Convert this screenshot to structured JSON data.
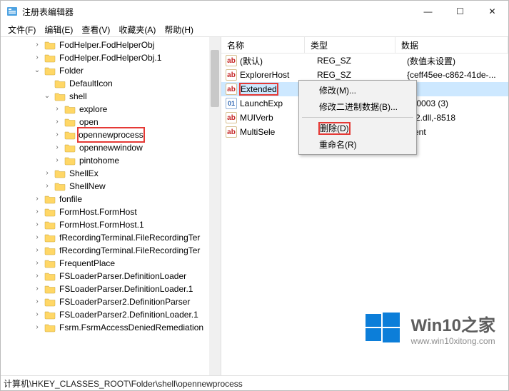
{
  "title": "注册表编辑器",
  "menu": {
    "file": "文件(F)",
    "edit": "编辑(E)",
    "view": "查看(V)",
    "fav": "收藏夹(A)",
    "help": "帮助(H)"
  },
  "tree": [
    {
      "d": 3,
      "tw": ">",
      "l": "FodHelper.FodHelperObj"
    },
    {
      "d": 3,
      "tw": ">",
      "l": "FodHelper.FodHelperObj.1"
    },
    {
      "d": 3,
      "tw": "v",
      "l": "Folder"
    },
    {
      "d": 4,
      "tw": "",
      "l": "DefaultIcon"
    },
    {
      "d": 4,
      "tw": "v",
      "l": "shell"
    },
    {
      "d": 5,
      "tw": ">",
      "l": "explore"
    },
    {
      "d": 5,
      "tw": ">",
      "l": "open"
    },
    {
      "d": 5,
      "tw": ">",
      "l": "opennewprocess",
      "hl": true
    },
    {
      "d": 5,
      "tw": ">",
      "l": "opennewwindow"
    },
    {
      "d": 5,
      "tw": ">",
      "l": "pintohome"
    },
    {
      "d": 4,
      "tw": ">",
      "l": "ShellEx"
    },
    {
      "d": 4,
      "tw": ">",
      "l": "ShellNew"
    },
    {
      "d": 3,
      "tw": ">",
      "l": "fonfile"
    },
    {
      "d": 3,
      "tw": ">",
      "l": "FormHost.FormHost"
    },
    {
      "d": 3,
      "tw": ">",
      "l": "FormHost.FormHost.1"
    },
    {
      "d": 3,
      "tw": ">",
      "l": "fRecordingTerminal.FileRecordingTer"
    },
    {
      "d": 3,
      "tw": ">",
      "l": "fRecordingTerminal.FileRecordingTer"
    },
    {
      "d": 3,
      "tw": ">",
      "l": "FrequentPlace"
    },
    {
      "d": 3,
      "tw": ">",
      "l": "FSLoaderParser.DefinitionLoader"
    },
    {
      "d": 3,
      "tw": ">",
      "l": "FSLoaderParser.DefinitionLoader.1"
    },
    {
      "d": 3,
      "tw": ">",
      "l": "FSLoaderParser2.DefinitionParser"
    },
    {
      "d": 3,
      "tw": ">",
      "l": "FSLoaderParser2.DefinitionLoader.1"
    },
    {
      "d": 3,
      "tw": ">",
      "l": "Fsrm.FsrmAccessDeniedRemediation"
    }
  ],
  "cols": {
    "name": "名称",
    "type": "类型",
    "data": "数据"
  },
  "values": [
    {
      "icon": "ab",
      "name": "(默认)",
      "type": "REG_SZ",
      "data": "(数值未设置)"
    },
    {
      "icon": "ab",
      "name": "ExplorerHost",
      "type": "REG_SZ",
      "data": "{ceff45ee-c862-41de-..."
    },
    {
      "icon": "ab",
      "name": "Extended",
      "type": "REG_SZ",
      "data": "",
      "sel": true,
      "hl": true
    },
    {
      "icon": "bin",
      "name": "LaunchExp",
      "type": "",
      "data": "000003 (3)"
    },
    {
      "icon": "ab",
      "name": "MUIVerb",
      "type": "",
      "data": "ll32.dll,-8518"
    },
    {
      "icon": "ab",
      "name": "MultiSele",
      "type": "",
      "data": "ment"
    }
  ],
  "ctx": {
    "modify": "修改(M)...",
    "modbin": "修改二进制数据(B)...",
    "del": "删除(D)",
    "rename": "重命名(R)"
  },
  "status": "计算机\\HKEY_CLASSES_ROOT\\Folder\\shell\\opennewprocess",
  "wm": {
    "a": "Win10之家",
    "b": "www.win10xitong.com"
  }
}
